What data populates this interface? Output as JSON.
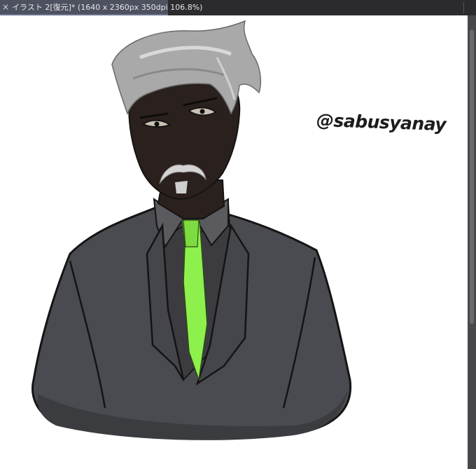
{
  "document_tab": {
    "close_glyph": "×",
    "title": "イラスト 2[復元]* (1640 x 2360px 350dpi 106.8%)"
  },
  "canvas": {
    "signature": "@sabusyanay",
    "colors": {
      "background": "#ffffff",
      "suit": "#4a4b50",
      "shirt": "#3c3c40",
      "tie": "#8ef04d",
      "skin": "#2a201d",
      "hair": "#a9a9a9",
      "outline": "#141414"
    }
  }
}
